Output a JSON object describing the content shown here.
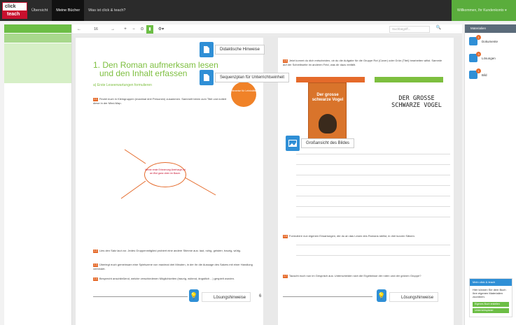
{
  "topbar": {
    "logo_top": "click",
    "logo_bottom": "teach",
    "tabs": [
      "Übersicht",
      "Meine Bücher",
      "Was ist click & teach?"
    ],
    "active_tab": 1,
    "account": "Willkommen, Ihr Kundenkonto ▾"
  },
  "toolbar": {
    "back": "←",
    "page": "16",
    "forward": "→",
    "zoom_in": "+",
    "zoom_out": "−",
    "fit": "⊙",
    "highlight": "▮",
    "tools": "⚙▾",
    "search_placeholder": "Suchbegriff...",
    "search_icon": "🔍"
  },
  "page_left": {
    "title_line1": "1. Den Roman aufmerksam lesen",
    "title_line2": "und den Inhalt erfassen",
    "subtitle": "a) Erste Leseerwartungen formulieren",
    "stamp": "Hinweise für Lehrkräfte",
    "task1_num": "1.1",
    "task1": "Findet euch in Kleingruppen (maximal drei Personen) zusammen. Sammelt Ideen zum Titel und notiert diese in der Mind-Map.",
    "mind_text": "Meine erste Erinnerung überhaupt ist an Wut ganz oben im Baum.",
    "task2_num": "1.2",
    "task2": "Lies den Satz laut vor. Jedes Gruppenmitglied probiert eine andere Stimme aus: laut, ruhig, geisterr, traurig, wütig.",
    "task3_num": "1.3",
    "task3": "Überlegt euch gemeinsam eine Spielszene von maximal drei Minuten, in der ihr die Aussage des Satzes mit einer Handlung verbindet.",
    "task4_num": "1.4",
    "task4": "Besprecht anschließend, welche verschiedenen Möglichkeiten (traurig, wütend, ängstlich ...) gespielt wurden.",
    "solution": "Lösungshinweise",
    "page_number": "6"
  },
  "page_right": {
    "task1_num": "1.5",
    "task1": "Jetzt kommt du dich entscheiden, ob du die Aufgabe für die Gruppe Rot (Cover) oder Grün (Titel) bearbeiten willst. Sammle auf der Schreibseite im anderen Feld, was dir dazu einfällt.",
    "cover_title": "Der grosse schwarze Vogel",
    "hand_title": "DER GROSSE SCHWARZE VOGEL",
    "task2_num": "1.6",
    "task2": "Formuliere nun eigenen Erwartungen, die du an das Lesen des Romans stellst, in drei kurzen Sätzen.",
    "task3_num": "1.7",
    "task3": "Tauscht euch nun im Gespräch aus: Unterscheiden sich die Ergebnisse der roten und der grünen Gruppe?",
    "solution": "Lösungshinweise"
  },
  "overlays": {
    "didaktik": "Didaktische Hinweise",
    "sequenz": "Sequenzplan für Unterrichtseinheit",
    "gross": "Großansicht des Bildes"
  },
  "rightbar": {
    "header": "Materialien",
    "items": [
      {
        "label": "Dokumente",
        "badge": "1"
      },
      {
        "label": "Lösungen",
        "badge": "3"
      },
      {
        "label": "Bild",
        "badge": "1"
      }
    ],
    "box_title": "Mein click & teach",
    "box_text": "Hier können Sie dem Buch Ihre eigenen Materialien zuordnen.",
    "box_btn1": "Eigenes Buch erstellen",
    "box_btn2": "Unterrichtsplaner"
  },
  "colors": {
    "accent_green": "#6cbe45",
    "accent_blue": "#2f8fd6",
    "accent_orange": "#e56a2a"
  }
}
